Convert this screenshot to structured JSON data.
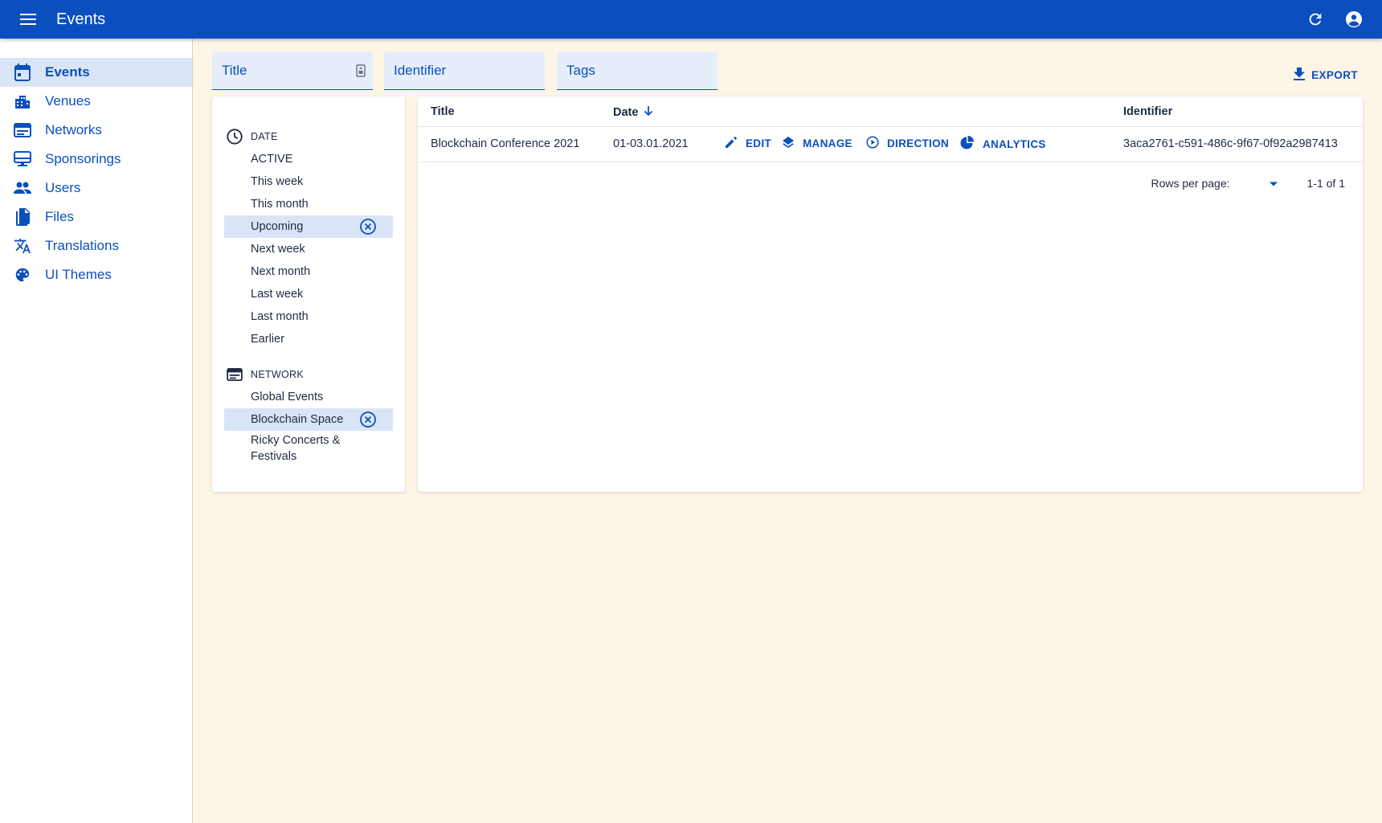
{
  "app": {
    "title": "Events"
  },
  "sidebar": {
    "items": [
      {
        "label": "Events",
        "icon": "calendar-icon",
        "active": true
      },
      {
        "label": "Venues",
        "icon": "building-icon"
      },
      {
        "label": "Networks",
        "icon": "web-icon"
      },
      {
        "label": "Sponsorings",
        "icon": "sponsor-icon"
      },
      {
        "label": "Users",
        "icon": "people-icon"
      },
      {
        "label": "Files",
        "icon": "files-icon"
      },
      {
        "label": "Translations",
        "icon": "translate-icon"
      },
      {
        "label": "UI Themes",
        "icon": "palette-icon"
      }
    ]
  },
  "filters": {
    "title_placeholder": "Title",
    "identifier_placeholder": "Identifier",
    "tags_placeholder": "Tags"
  },
  "export_label": "EXPORT",
  "filter_panel": {
    "date": {
      "heading": "DATE",
      "options": [
        "ACTIVE",
        "This week",
        "This month",
        "Upcoming",
        "Next week",
        "Next month",
        "Last week",
        "Last month",
        "Earlier"
      ],
      "selected": "Upcoming"
    },
    "network": {
      "heading": "NETWORK",
      "options": [
        "Global Events",
        "Blockchain Space",
        "Ricky Concerts & Festivals"
      ],
      "selected": "Blockchain Space"
    }
  },
  "table": {
    "columns": {
      "title": "Title",
      "date": "Date",
      "identifier": "Identifier"
    },
    "rows": [
      {
        "title": "Blockchain Conference 2021",
        "date": "01-03.01.2021",
        "identifier": "3aca2761-c591-486c-9f67-0f92a2987413",
        "actions": {
          "edit": "EDIT",
          "manage": "MANAGE",
          "direction": "DIRECTION",
          "analytics": "ANALYTICS"
        }
      }
    ],
    "pagination": {
      "rows_per_page_label": "Rows per page:",
      "range": "1-1 of 1"
    }
  },
  "colors": {
    "primary": "#0b4fbf",
    "background": "#fdf5e6",
    "selected": "#d9e5f7",
    "field": "#e6eefb"
  }
}
